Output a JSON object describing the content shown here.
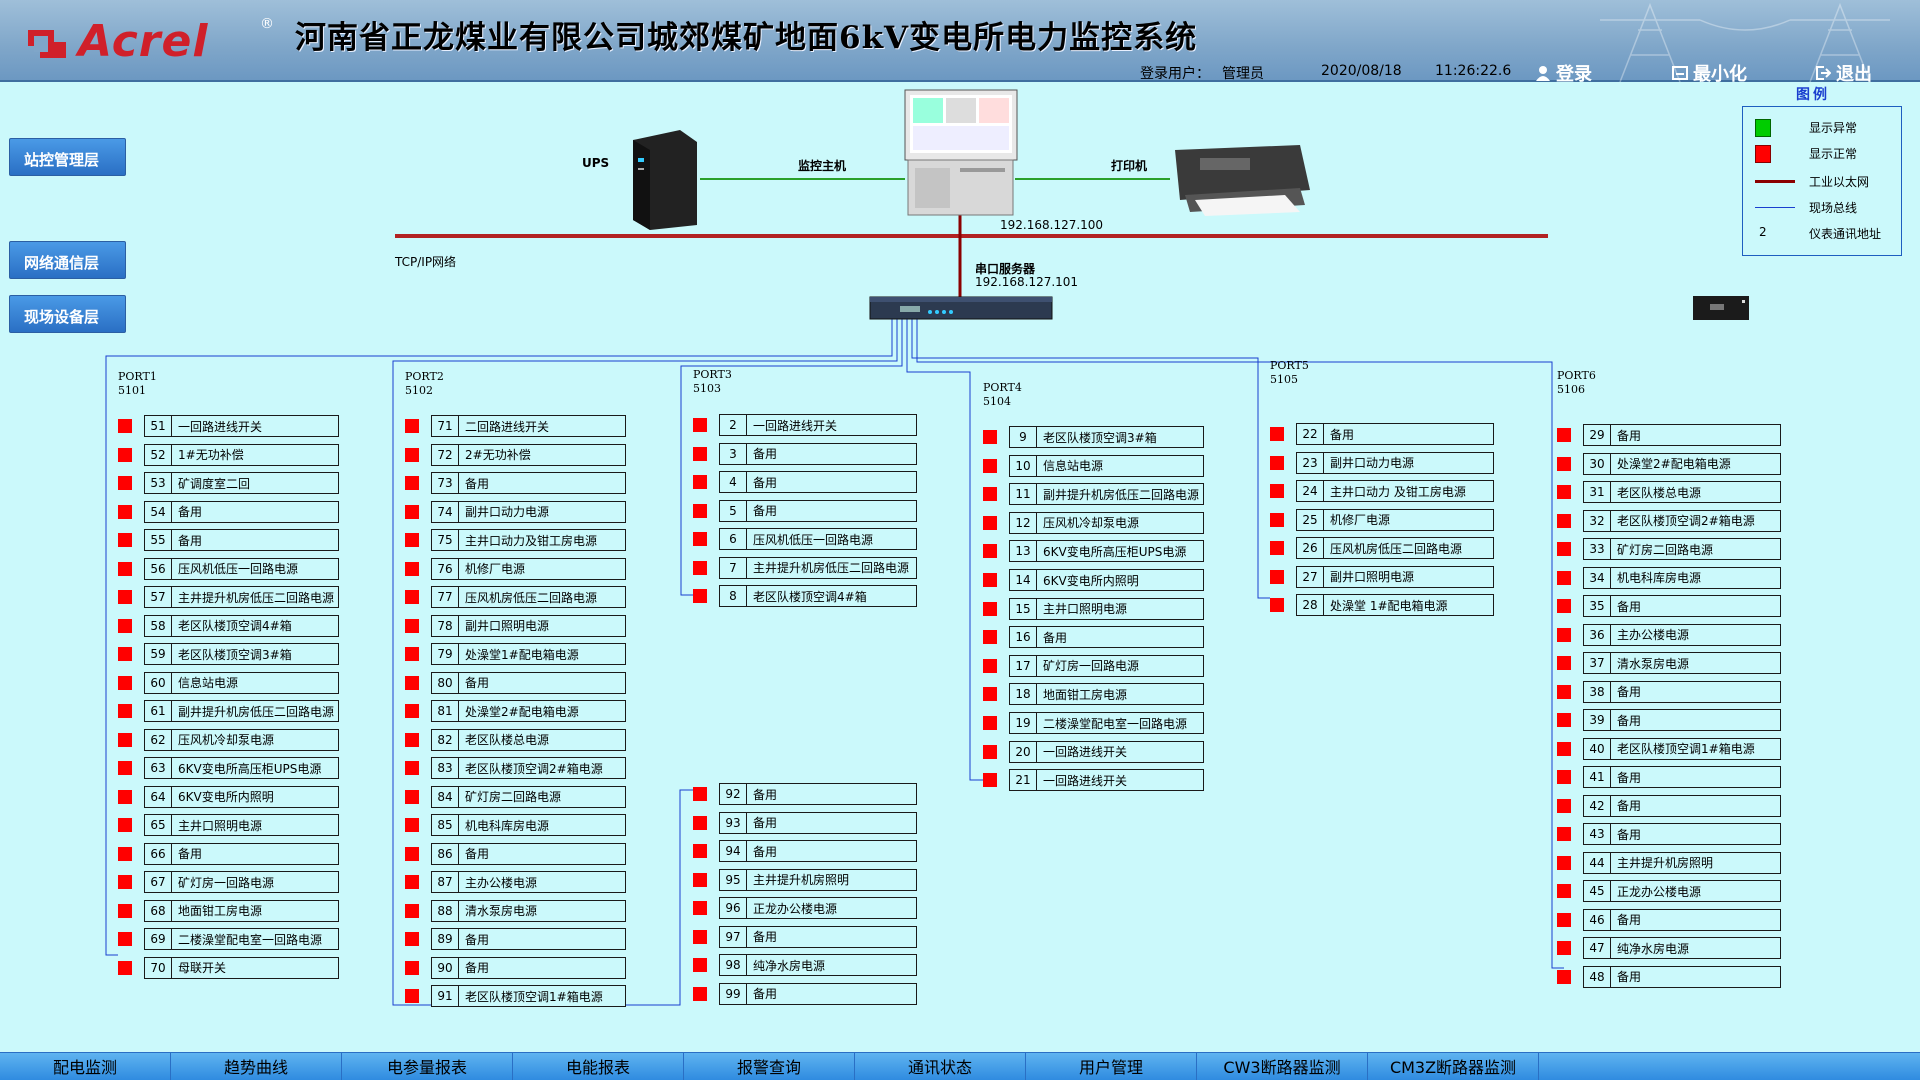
{
  "header": {
    "logo_text": "Acrel",
    "logo_reg": "®",
    "title": "河南省正龙煤业有限公司城郊煤矿地面6kV变电所电力监控系统",
    "login_label": "登录用户：",
    "user": "管理员",
    "date": "2020/08/18",
    "time": "11:26:22.6",
    "btn_login": "登录",
    "btn_minimize": "最小化",
    "btn_exit": "退出"
  },
  "layers": {
    "station": "站控管理层",
    "network": "网络通信层",
    "field": "现场设备层"
  },
  "legend": {
    "title": "图例",
    "items": [
      {
        "label": "显示异常",
        "color": "#00cc00"
      },
      {
        "label": "显示正常",
        "color": "#ff0000"
      },
      {
        "label": "工业以太网",
        "color": "#8b0000"
      },
      {
        "label": "现场总线",
        "color": "#1a3fcf"
      },
      {
        "label": "仪表通讯地址",
        "symbol": "2"
      }
    ]
  },
  "devices": {
    "ups": "UPS",
    "host": "监控主机",
    "printer": "打印机",
    "host_ip": "192.168.127.100",
    "tcpip": "TCP/IP网络",
    "serial_server": "串口服务器",
    "serial_ip": "192.168.127.101"
  },
  "ports": [
    {
      "name": "PORT1",
      "addr": "5101",
      "rows": [
        {
          "n": "51",
          "t": "一回路进线开关"
        },
        {
          "n": "52",
          "t": "1#无功补偿"
        },
        {
          "n": "53",
          "t": "矿调度室二回"
        },
        {
          "n": "54",
          "t": "备用"
        },
        {
          "n": "55",
          "t": "备用"
        },
        {
          "n": "56",
          "t": "压风机低压一回路电源"
        },
        {
          "n": "57",
          "t": "主井提升机房低压二回路电源"
        },
        {
          "n": "58",
          "t": "老区队楼顶空调4#箱"
        },
        {
          "n": "59",
          "t": "老区队楼顶空调3#箱"
        },
        {
          "n": "60",
          "t": "信息站电源"
        },
        {
          "n": "61",
          "t": "副井提升机房低压二回路电源"
        },
        {
          "n": "62",
          "t": "压风机冷却泵电源"
        },
        {
          "n": "63",
          "t": "6KV变电所高压柜UPS电源"
        },
        {
          "n": "64",
          "t": "6KV变电所内照明"
        },
        {
          "n": "65",
          "t": "主井口照明电源"
        },
        {
          "n": "66",
          "t": "备用"
        },
        {
          "n": "67",
          "t": "矿灯房一回路电源"
        },
        {
          "n": "68",
          "t": "地面钳工房电源"
        },
        {
          "n": "69",
          "t": "二楼澡堂配电室一回路电源"
        },
        {
          "n": "70",
          "t": "母联开关"
        }
      ]
    },
    {
      "name": "PORT2",
      "addr": "5102",
      "rows": [
        {
          "n": "71",
          "t": "二回路进线开关"
        },
        {
          "n": "72",
          "t": "2#无功补偿"
        },
        {
          "n": "73",
          "t": "备用"
        },
        {
          "n": "74",
          "t": "副井口动力电源"
        },
        {
          "n": "75",
          "t": "主井口动力及钳工房电源"
        },
        {
          "n": "76",
          "t": "机修厂电源"
        },
        {
          "n": "77",
          "t": "压风机房低压二回路电源"
        },
        {
          "n": "78",
          "t": "副井口照明电源"
        },
        {
          "n": "79",
          "t": "处澡堂1#配电箱电源"
        },
        {
          "n": "80",
          "t": "备用"
        },
        {
          "n": "81",
          "t": "处澡堂2#配电箱电源"
        },
        {
          "n": "82",
          "t": "老区队楼总电源"
        },
        {
          "n": "83",
          "t": "老区队楼顶空调2#箱电源"
        },
        {
          "n": "84",
          "t": "矿灯房二回路电源"
        },
        {
          "n": "85",
          "t": "机电科库房电源"
        },
        {
          "n": "86",
          "t": "备用"
        },
        {
          "n": "87",
          "t": "主办公楼电源"
        },
        {
          "n": "88",
          "t": "清水泵房电源"
        },
        {
          "n": "89",
          "t": "备用"
        },
        {
          "n": "90",
          "t": "备用"
        },
        {
          "n": "91",
          "t": "老区队楼顶空调1#箱电源"
        }
      ]
    },
    {
      "name": "PORT3",
      "addr": "5103",
      "rows": [
        {
          "n": "2",
          "t": "一回路进线开关"
        },
        {
          "n": "3",
          "t": "备用"
        },
        {
          "n": "4",
          "t": "备用"
        },
        {
          "n": "5",
          "t": "备用"
        },
        {
          "n": "6",
          "t": "压风机低压一回路电源"
        },
        {
          "n": "7",
          "t": "主井提升机房低压二回路电源"
        },
        {
          "n": "8",
          "t": "老区队楼顶空调4#箱"
        }
      ]
    },
    {
      "name": "",
      "addr": "",
      "rows": [
        {
          "n": "92",
          "t": "备用"
        },
        {
          "n": "93",
          "t": "备用"
        },
        {
          "n": "94",
          "t": "备用"
        },
        {
          "n": "95",
          "t": "主井提升机房照明"
        },
        {
          "n": "96",
          "t": "正龙办公楼电源"
        },
        {
          "n": "97",
          "t": "备用"
        },
        {
          "n": "98",
          "t": "纯净水房电源"
        },
        {
          "n": "99",
          "t": "备用"
        }
      ]
    },
    {
      "name": "PORT4",
      "addr": "5104",
      "rows": [
        {
          "n": "9",
          "t": "老区队楼顶空调3#箱"
        },
        {
          "n": "10",
          "t": "信息站电源"
        },
        {
          "n": "11",
          "t": "副井提升机房低压二回路电源"
        },
        {
          "n": "12",
          "t": "压风机冷却泵电源"
        },
        {
          "n": "13",
          "t": "6KV变电所高压柜UPS电源"
        },
        {
          "n": "14",
          "t": "6KV变电所内照明"
        },
        {
          "n": "15",
          "t": "主井口照明电源"
        },
        {
          "n": "16",
          "t": "备用"
        },
        {
          "n": "17",
          "t": "矿灯房一回路电源"
        },
        {
          "n": "18",
          "t": "地面钳工房电源"
        },
        {
          "n": "19",
          "t": "二楼澡堂配电室一回路电源"
        },
        {
          "n": "20",
          "t": "一回路进线开关"
        },
        {
          "n": "21",
          "t": "一回路进线开关"
        }
      ]
    },
    {
      "name": "PORT5",
      "addr": "5105",
      "rows": [
        {
          "n": "22",
          "t": "备用"
        },
        {
          "n": "23",
          "t": "副井口动力电源"
        },
        {
          "n": "24",
          "t": "主井口动力 及钳工房电源"
        },
        {
          "n": "25",
          "t": "机修厂电源"
        },
        {
          "n": "26",
          "t": "压风机房低压二回路电源"
        },
        {
          "n": "27",
          "t": "副井口照明电源"
        },
        {
          "n": "28",
          "t": "处澡堂 1#配电箱电源"
        }
      ]
    },
    {
      "name": "PORT6",
      "addr": "5106",
      "rows": [
        {
          "n": "29",
          "t": "备用"
        },
        {
          "n": "30",
          "t": "处澡堂2#配电箱电源"
        },
        {
          "n": "31",
          "t": "老区队楼总电源"
        },
        {
          "n": "32",
          "t": "老区队楼顶空调2#箱电源"
        },
        {
          "n": "33",
          "t": "矿灯房二回路电源"
        },
        {
          "n": "34",
          "t": "机电科库房电源"
        },
        {
          "n": "35",
          "t": "备用"
        },
        {
          "n": "36",
          "t": "主办公楼电源"
        },
        {
          "n": "37",
          "t": "清水泵房电源"
        },
        {
          "n": "38",
          "t": "备用"
        },
        {
          "n": "39",
          "t": "备用"
        },
        {
          "n": "40",
          "t": "老区队楼顶空调1#箱电源"
        },
        {
          "n": "41",
          "t": "备用"
        },
        {
          "n": "42",
          "t": "备用"
        },
        {
          "n": "43",
          "t": "备用"
        },
        {
          "n": "44",
          "t": "主井提升机房照明"
        },
        {
          "n": "45",
          "t": "正龙办公楼电源"
        },
        {
          "n": "46",
          "t": "备用"
        },
        {
          "n": "47",
          "t": "纯净水房电源"
        },
        {
          "n": "48",
          "t": "备用"
        }
      ]
    }
  ],
  "nav": [
    "配电监测",
    "趋势曲线",
    "电参量报表",
    "电能报表",
    "报警查询",
    "通讯状态",
    "用户管理",
    "CW3断路器监测",
    "CM3Z断路器监测"
  ]
}
